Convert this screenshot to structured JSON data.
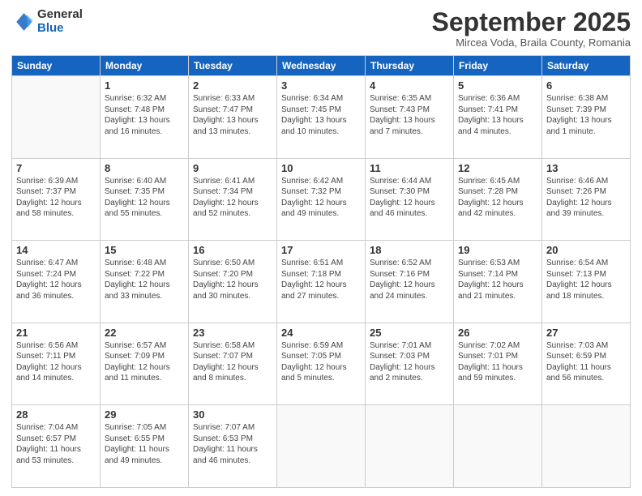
{
  "logo": {
    "general": "General",
    "blue": "Blue"
  },
  "header": {
    "month": "September 2025",
    "location": "Mircea Voda, Braila County, Romania"
  },
  "weekdays": [
    "Sunday",
    "Monday",
    "Tuesday",
    "Wednesday",
    "Thursday",
    "Friday",
    "Saturday"
  ],
  "weeks": [
    [
      {
        "day": null
      },
      {
        "day": 1,
        "sunrise": "6:32 AM",
        "sunset": "7:48 PM",
        "daylight": "13 hours and 16 minutes."
      },
      {
        "day": 2,
        "sunrise": "6:33 AM",
        "sunset": "7:47 PM",
        "daylight": "13 hours and 13 minutes."
      },
      {
        "day": 3,
        "sunrise": "6:34 AM",
        "sunset": "7:45 PM",
        "daylight": "13 hours and 10 minutes."
      },
      {
        "day": 4,
        "sunrise": "6:35 AM",
        "sunset": "7:43 PM",
        "daylight": "13 hours and 7 minutes."
      },
      {
        "day": 5,
        "sunrise": "6:36 AM",
        "sunset": "7:41 PM",
        "daylight": "13 hours and 4 minutes."
      },
      {
        "day": 6,
        "sunrise": "6:38 AM",
        "sunset": "7:39 PM",
        "daylight": "13 hours and 1 minute."
      }
    ],
    [
      {
        "day": 7,
        "sunrise": "6:39 AM",
        "sunset": "7:37 PM",
        "daylight": "12 hours and 58 minutes."
      },
      {
        "day": 8,
        "sunrise": "6:40 AM",
        "sunset": "7:35 PM",
        "daylight": "12 hours and 55 minutes."
      },
      {
        "day": 9,
        "sunrise": "6:41 AM",
        "sunset": "7:34 PM",
        "daylight": "12 hours and 52 minutes."
      },
      {
        "day": 10,
        "sunrise": "6:42 AM",
        "sunset": "7:32 PM",
        "daylight": "12 hours and 49 minutes."
      },
      {
        "day": 11,
        "sunrise": "6:44 AM",
        "sunset": "7:30 PM",
        "daylight": "12 hours and 46 minutes."
      },
      {
        "day": 12,
        "sunrise": "6:45 AM",
        "sunset": "7:28 PM",
        "daylight": "12 hours and 42 minutes."
      },
      {
        "day": 13,
        "sunrise": "6:46 AM",
        "sunset": "7:26 PM",
        "daylight": "12 hours and 39 minutes."
      }
    ],
    [
      {
        "day": 14,
        "sunrise": "6:47 AM",
        "sunset": "7:24 PM",
        "daylight": "12 hours and 36 minutes."
      },
      {
        "day": 15,
        "sunrise": "6:48 AM",
        "sunset": "7:22 PM",
        "daylight": "12 hours and 33 minutes."
      },
      {
        "day": 16,
        "sunrise": "6:50 AM",
        "sunset": "7:20 PM",
        "daylight": "12 hours and 30 minutes."
      },
      {
        "day": 17,
        "sunrise": "6:51 AM",
        "sunset": "7:18 PM",
        "daylight": "12 hours and 27 minutes."
      },
      {
        "day": 18,
        "sunrise": "6:52 AM",
        "sunset": "7:16 PM",
        "daylight": "12 hours and 24 minutes."
      },
      {
        "day": 19,
        "sunrise": "6:53 AM",
        "sunset": "7:14 PM",
        "daylight": "12 hours and 21 minutes."
      },
      {
        "day": 20,
        "sunrise": "6:54 AM",
        "sunset": "7:13 PM",
        "daylight": "12 hours and 18 minutes."
      }
    ],
    [
      {
        "day": 21,
        "sunrise": "6:56 AM",
        "sunset": "7:11 PM",
        "daylight": "12 hours and 14 minutes."
      },
      {
        "day": 22,
        "sunrise": "6:57 AM",
        "sunset": "7:09 PM",
        "daylight": "12 hours and 11 minutes."
      },
      {
        "day": 23,
        "sunrise": "6:58 AM",
        "sunset": "7:07 PM",
        "daylight": "12 hours and 8 minutes."
      },
      {
        "day": 24,
        "sunrise": "6:59 AM",
        "sunset": "7:05 PM",
        "daylight": "12 hours and 5 minutes."
      },
      {
        "day": 25,
        "sunrise": "7:01 AM",
        "sunset": "7:03 PM",
        "daylight": "12 hours and 2 minutes."
      },
      {
        "day": 26,
        "sunrise": "7:02 AM",
        "sunset": "7:01 PM",
        "daylight": "11 hours and 59 minutes."
      },
      {
        "day": 27,
        "sunrise": "7:03 AM",
        "sunset": "6:59 PM",
        "daylight": "11 hours and 56 minutes."
      }
    ],
    [
      {
        "day": 28,
        "sunrise": "7:04 AM",
        "sunset": "6:57 PM",
        "daylight": "11 hours and 53 minutes."
      },
      {
        "day": 29,
        "sunrise": "7:05 AM",
        "sunset": "6:55 PM",
        "daylight": "11 hours and 49 minutes."
      },
      {
        "day": 30,
        "sunrise": "7:07 AM",
        "sunset": "6:53 PM",
        "daylight": "11 hours and 46 minutes."
      },
      {
        "day": null
      },
      {
        "day": null
      },
      {
        "day": null
      },
      {
        "day": null
      }
    ]
  ],
  "labels": {
    "sunrise": "Sunrise:",
    "sunset": "Sunset:",
    "daylight": "Daylight:"
  }
}
